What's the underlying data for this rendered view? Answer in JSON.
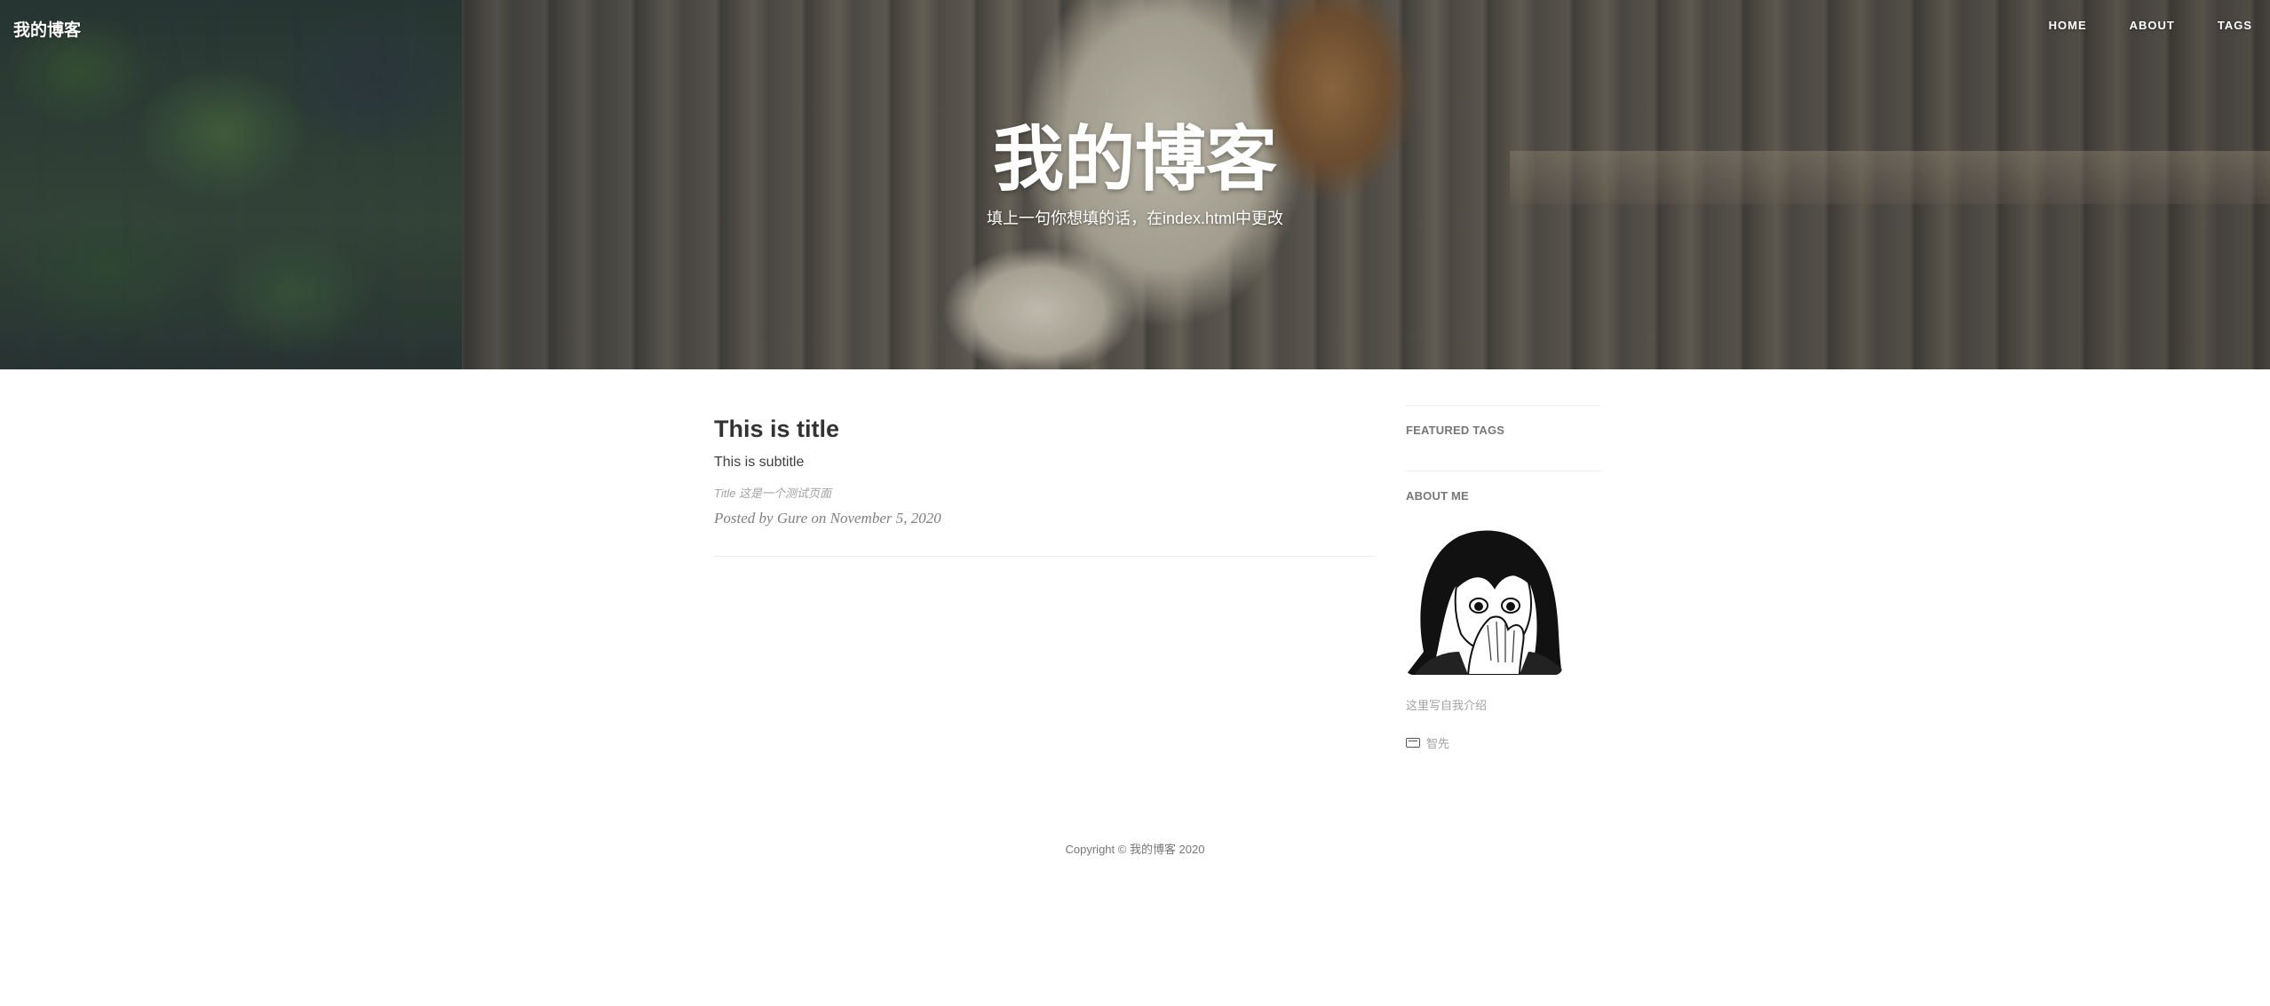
{
  "navbar": {
    "brand": "我的博客",
    "links": [
      "HOME",
      "ABOUT",
      "TAGS"
    ]
  },
  "header": {
    "title": "我的博客",
    "subtitle": "填上一句你想填的话，在index.html中更改"
  },
  "post": {
    "title": "This is title",
    "subtitle": "This is subtitle",
    "tags": "Title 这是一个测试页面",
    "meta": "Posted by Gure on November 5, 2020"
  },
  "sidebar": {
    "featured_tags_title": "FEATURED TAGS",
    "about_title": "ABOUT ME",
    "about_text": "这里写自我介绍",
    "contact_label": "智先"
  },
  "footer": {
    "copyright": "Copyright © 我的博客 2020"
  },
  "icons": {
    "contact": "envelope-icon"
  }
}
